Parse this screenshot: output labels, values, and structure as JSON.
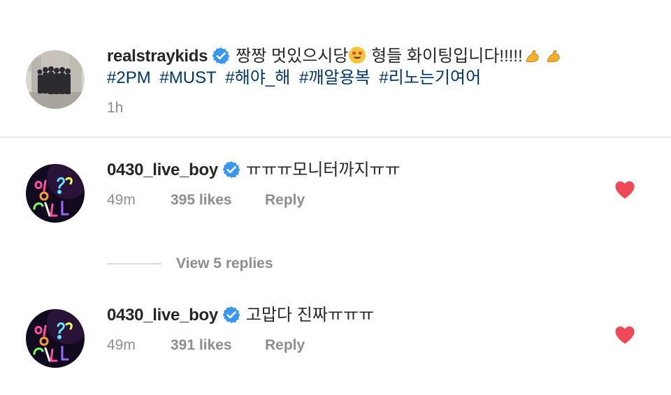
{
  "post": {
    "username": "realstraykids",
    "caption": "짱짱 멋있으시당",
    "caption_after_emoji": " 형들 화이팅입니다!!!!!",
    "emoji_heart_eyes": "😍",
    "emoji_muscle": "💪",
    "hashtags": [
      "#2PM",
      "#MUST",
      "#해야_해",
      "#깨알용복",
      "#리노는기여어"
    ],
    "time": "1h"
  },
  "comments": [
    {
      "username": "0430_live_boy",
      "text": "ㅠㅠㅠ모니터까지ㅠㅠ",
      "time": "49m",
      "likes": "395 likes",
      "reply_label": "Reply",
      "liked": true
    },
    {
      "username": "0430_live_boy",
      "text": "고맙다 진짜ㅠㅠㅠ",
      "time": "49m",
      "likes": "391 likes",
      "reply_label": "Reply",
      "liked": true
    }
  ],
  "view_replies": "View 5 replies",
  "colors": {
    "text": "#262626",
    "muted": "#8e8e8e",
    "hashtag": "#003569",
    "verified": "#3897f0",
    "heart": "#ed4956",
    "divider": "#dbdbdb"
  }
}
